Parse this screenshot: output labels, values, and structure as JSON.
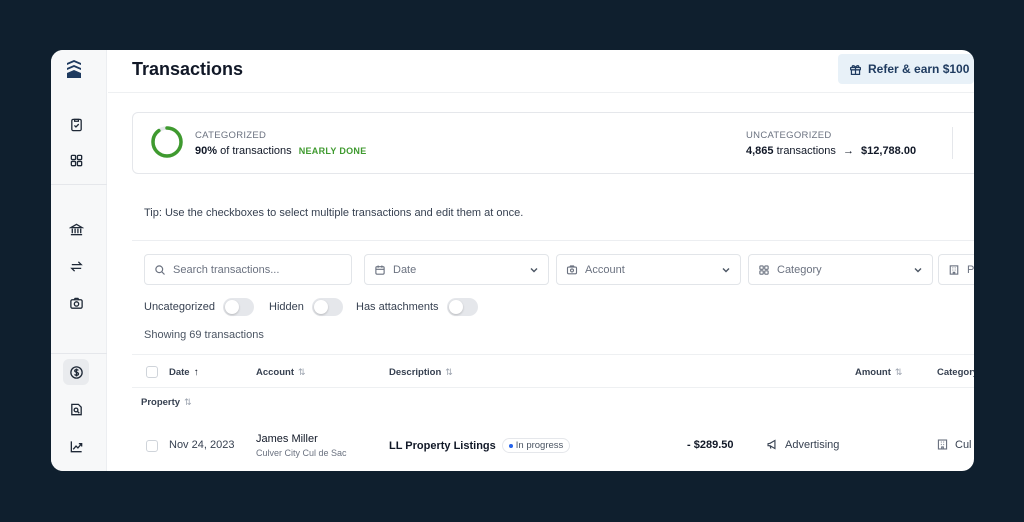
{
  "header": {
    "title": "Transactions",
    "refer_label": "Refer & earn $100"
  },
  "sidebar": {
    "items": [
      {
        "icon": "clipboard-check-icon"
      },
      {
        "icon": "grid-icon"
      },
      {
        "icon": "bank-icon"
      },
      {
        "icon": "transfer-arrows-icon"
      },
      {
        "icon": "camera-receipt-icon"
      },
      {
        "icon": "dollar-circle-icon",
        "active": true
      },
      {
        "icon": "document-search-icon"
      },
      {
        "icon": "trend-chart-icon"
      }
    ]
  },
  "summary": {
    "categorized_label": "CATEGORIZED",
    "categorized_percent": "90%",
    "categorized_text": "of transactions",
    "categorized_progress": 0.9,
    "status": "NEARLY DONE",
    "uncategorized_label": "UNCATEGORIZED",
    "uncategorized_count": "4,865",
    "uncategorized_text": "transactions",
    "arrow": "→",
    "uncategorized_amount": "$12,788.00"
  },
  "tip": "Tip: Use the checkboxes to select multiple transactions and edit them at once.",
  "filters": {
    "search_placeholder": "Search transactions...",
    "date_label": "Date",
    "account_label": "Account",
    "category_label": "Category",
    "property_label": "Pr"
  },
  "toggles": {
    "uncategorized": "Uncategorized",
    "hidden": "Hidden",
    "attachments": "Has attachments"
  },
  "showing": "Showing 69 transactions",
  "table": {
    "columns": {
      "date": "Date",
      "date_sort": "↑",
      "account": "Account",
      "description": "Description",
      "amount": "Amount",
      "category": "Category"
    },
    "group": "Property",
    "rows": [
      {
        "date": "Nov 24, 2023",
        "account_name": "James Miller",
        "account_sub": "Culver City Cul de Sac",
        "description": "LL Property Listings",
        "status": "In progress",
        "amount": "- $289.50",
        "category": "Advertising",
        "property": "Cul"
      }
    ]
  },
  "colors": {
    "background": "#0f1f2e",
    "accent_green": "#3f9a2f",
    "refer_bg": "#e8f1f8"
  }
}
